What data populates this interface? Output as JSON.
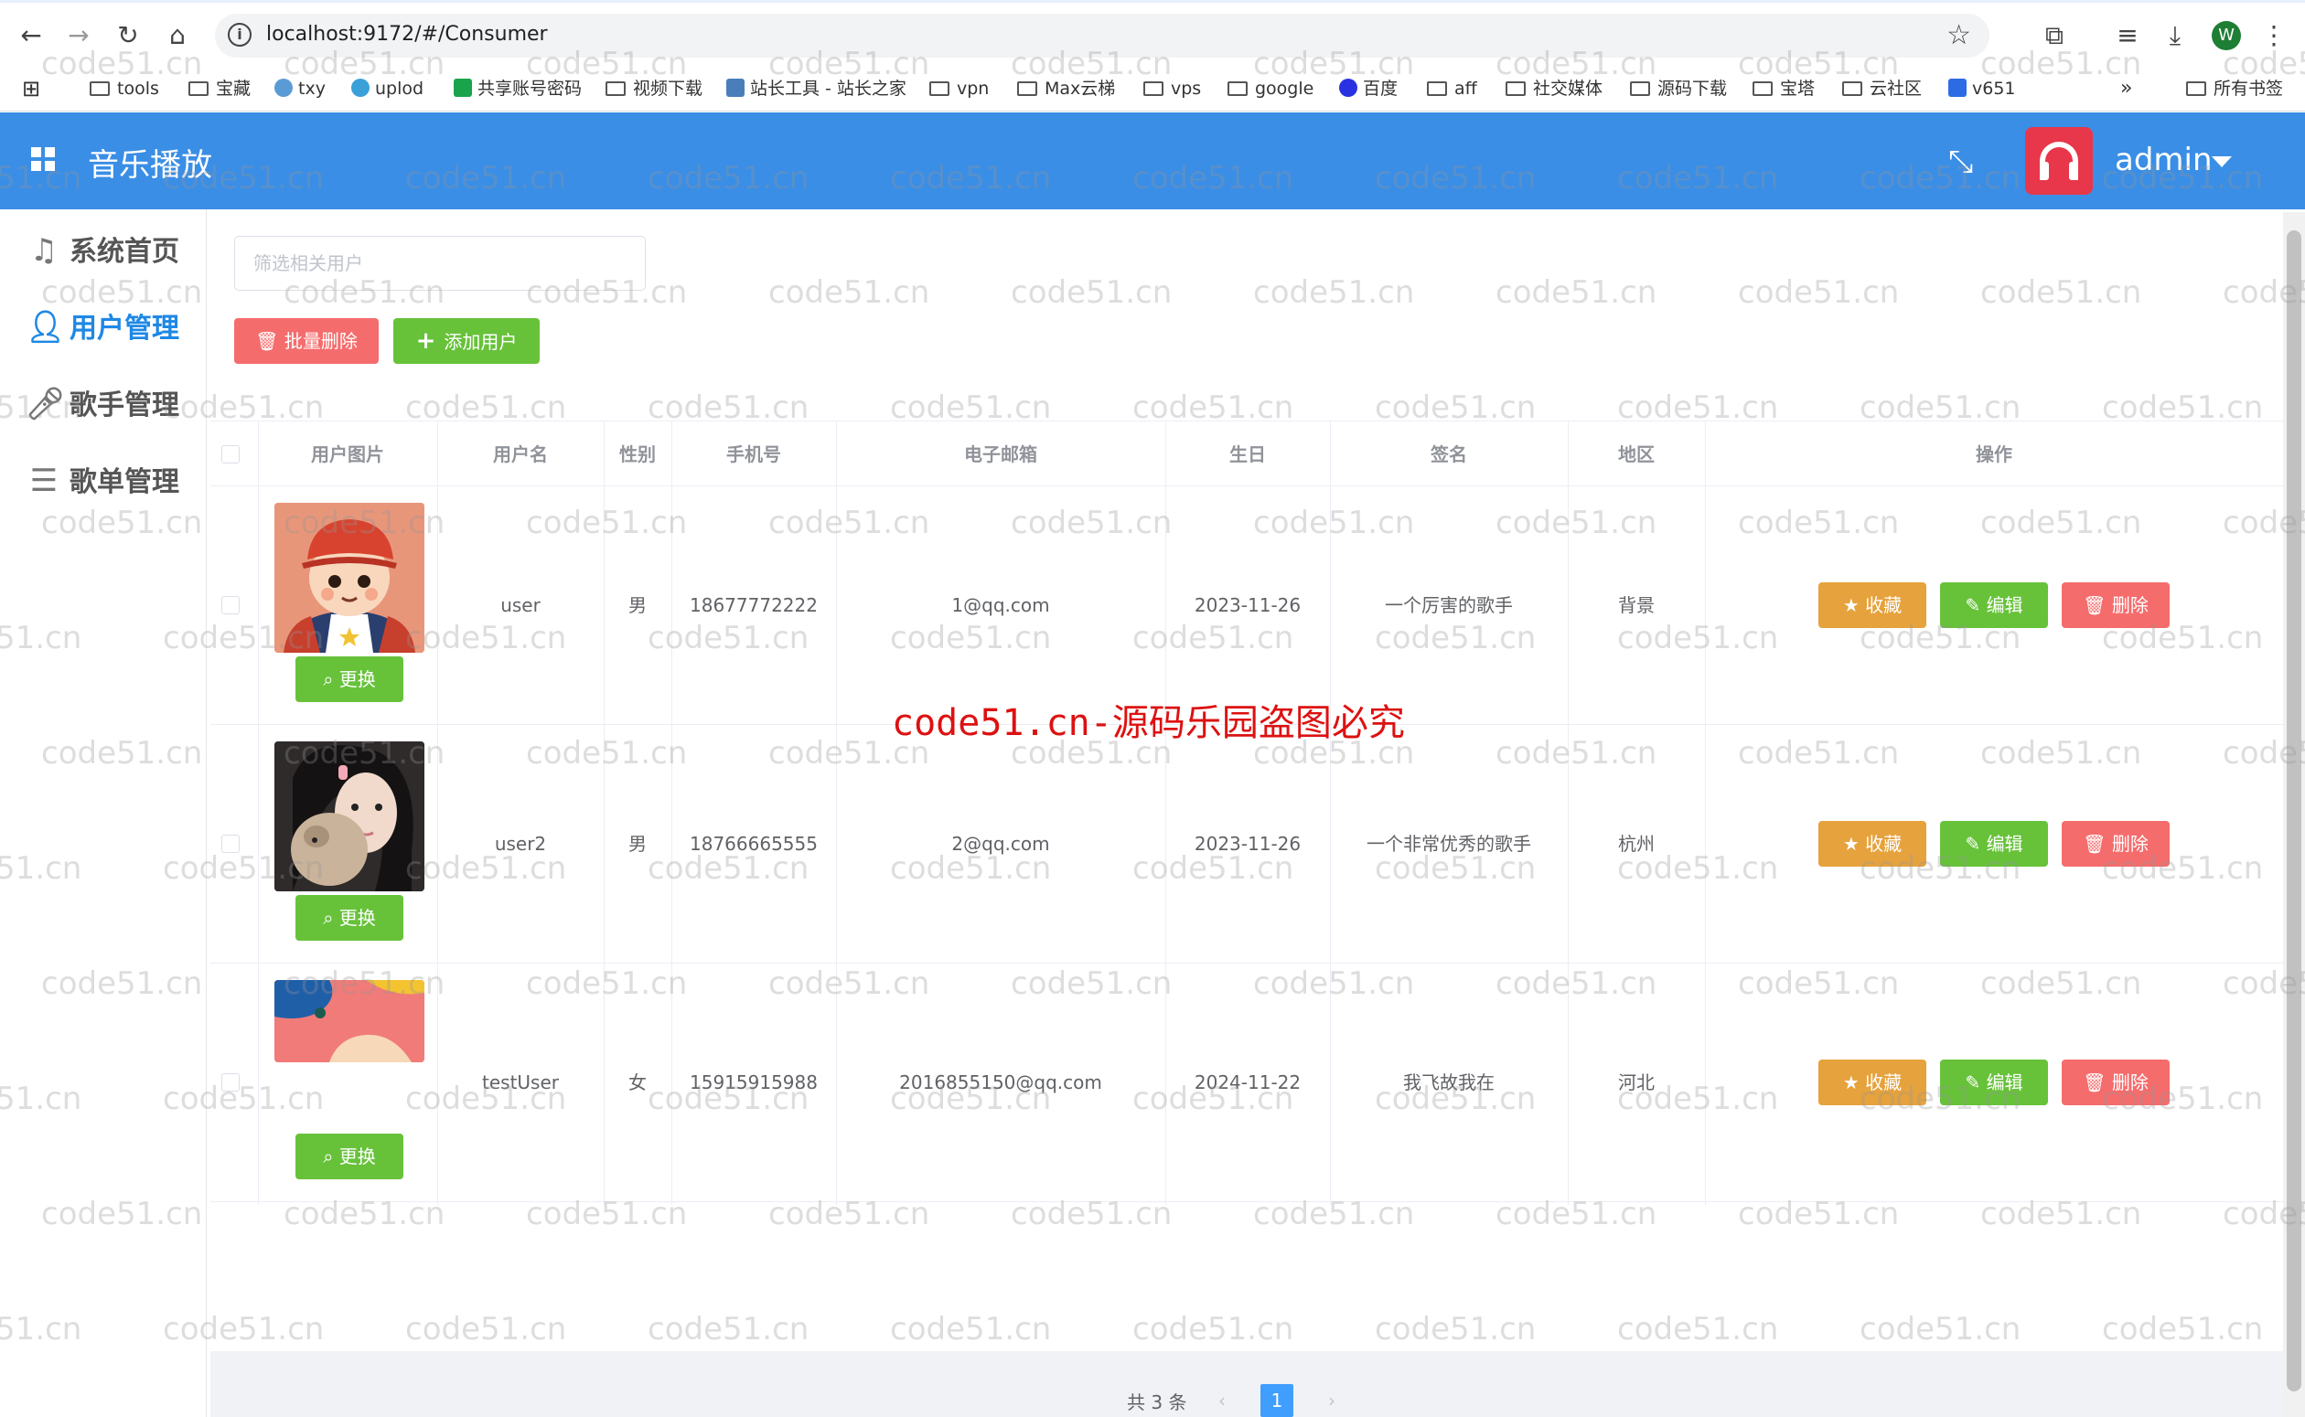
{
  "browser": {
    "url": "localhost:9172/#/Consumer",
    "profile_initial": "W",
    "bookmarks": [
      "tools",
      "宝藏",
      "txy",
      "uplod",
      "共享账号密码",
      "视频下载",
      "站长工具 - 站长之家",
      "vpn",
      "Max云梯",
      "vps",
      "google",
      "百度",
      "aff",
      "社交媒体",
      "源码下载",
      "宝塔",
      "云社区",
      "v651"
    ],
    "more": "»",
    "all_bookmarks": "所有书签"
  },
  "header": {
    "title": "音乐播放",
    "username": "admin"
  },
  "sidebar": {
    "items": [
      {
        "label": "系统首页",
        "icon": "music-note-icon"
      },
      {
        "label": "用户管理",
        "icon": "user-icon"
      },
      {
        "label": "歌手管理",
        "icon": "microphone-icon"
      },
      {
        "label": "歌单管理",
        "icon": "playlist-icon"
      }
    ]
  },
  "toolbar": {
    "search_placeholder": "筛选相关用户",
    "batch_delete": "批量删除",
    "add_user": "添加用户"
  },
  "table": {
    "columns": [
      "用户图片",
      "用户名",
      "性别",
      "手机号",
      "电子邮箱",
      "生日",
      "签名",
      "地区",
      "操作"
    ],
    "rows": [
      {
        "username": "user",
        "gender": "男",
        "phone": "18677772222",
        "email": "1@qq.com",
        "birthday": "2023-11-26",
        "signature": "一个厉害的歌手",
        "region": "背景"
      },
      {
        "username": "user2",
        "gender": "男",
        "phone": "18766665555",
        "email": "2@qq.com",
        "birthday": "2023-11-26",
        "signature": "一个非常优秀的歌手",
        "region": "杭州"
      },
      {
        "username": "testUser",
        "gender": "女",
        "phone": "15915915988",
        "email": "2016855150@qq.com",
        "birthday": "2024-11-22",
        "signature": "我飞故我在",
        "region": "河北"
      }
    ],
    "actions": {
      "change": "更换",
      "favorite": "收藏",
      "edit": "编辑",
      "delete": "删除"
    }
  },
  "pagination": {
    "total": "共 3 条",
    "current": "1",
    "prev": "‹",
    "next": "›"
  },
  "watermark": {
    "text": "code51.cn",
    "center": "code51.cn-源码乐园盗图必究"
  },
  "colors": {
    "header": "#3a8ee6",
    "active": "#1e88e5",
    "danger": "#f56c6c",
    "success": "#67c23a",
    "warning": "#e6a23c"
  }
}
